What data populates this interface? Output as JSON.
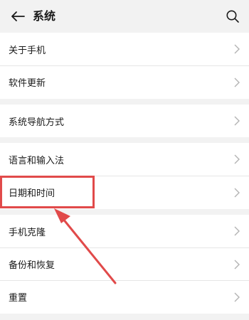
{
  "header": {
    "title": "系统"
  },
  "groups": [
    {
      "items": [
        {
          "label": "关于手机"
        },
        {
          "label": "软件更新"
        }
      ]
    },
    {
      "items": [
        {
          "label": "系统导航方式"
        }
      ]
    },
    {
      "items": [
        {
          "label": "语言和输入法"
        },
        {
          "label": "日期和时间"
        }
      ]
    },
    {
      "items": [
        {
          "label": "手机克隆"
        },
        {
          "label": "备份和恢复"
        },
        {
          "label": "重置"
        }
      ]
    }
  ],
  "annotation": {
    "color": "#e14a4a",
    "highlight_target": "日期和时间"
  },
  "icons": {
    "back": "back-arrow-icon",
    "search": "search-icon",
    "row_chevron": "chevron-right-icon"
  }
}
